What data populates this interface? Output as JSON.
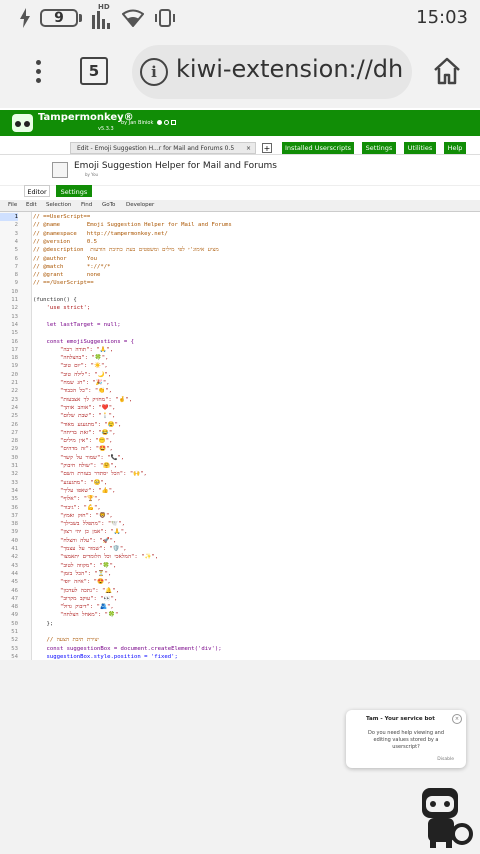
{
  "status_bar": {
    "battery_level": "9",
    "network": "HD",
    "time": "15:03"
  },
  "browser": {
    "tab_count": "5",
    "url": "kiwi-extension://dhc"
  },
  "tampermonkey": {
    "title": "Tampermonkey®",
    "by": "by Jan Biniok",
    "version": "v5.3.3",
    "edit_tab_label": "Edit - Emoji Suggestion H...r for Mail and Forums 0.5",
    "close_glyph": "×",
    "plus_glyph": "+",
    "nav": [
      "Installed Userscripts",
      "Settings",
      "Utilities",
      "Help"
    ]
  },
  "script": {
    "title": "Emoji Suggestion Helper for Mail and Forums",
    "by": "by You",
    "subtabs": [
      "Editor",
      "Settings"
    ]
  },
  "editor_menu": [
    "File",
    "Edit",
    "Selection",
    "Find",
    "GoTo",
    "Developer"
  ],
  "code_lines": [
    {
      "n": "1",
      "t": "// ==UserScript==",
      "c": "comment"
    },
    {
      "n": "2",
      "t": "// @name        Emoji Suggestion Helper for Mail and Forums",
      "c": "comment"
    },
    {
      "n": "3",
      "t": "// @namespace   http://tampermonkey.net/",
      "c": "comment"
    },
    {
      "n": "4",
      "t": "// @version     0.5",
      "c": "comment"
    },
    {
      "n": "5",
      "t": "// @description  מציע אימוג'י לפי מילים ומשפטים בעת כתיבת הודעות",
      "c": "comment"
    },
    {
      "n": "6",
      "t": "// @author      You",
      "c": "comment"
    },
    {
      "n": "7",
      "t": "// @match       *://*/*",
      "c": "comment"
    },
    {
      "n": "8",
      "t": "// @grant       none",
      "c": "comment"
    },
    {
      "n": "9",
      "t": "// ==/UserScript==",
      "c": "comment"
    },
    {
      "n": "10",
      "t": "",
      "c": "plain"
    },
    {
      "n": "11",
      "t": "(function() {",
      "c": "plain"
    },
    {
      "n": "12",
      "t": "    'use strict';",
      "c": "str"
    },
    {
      "n": "13",
      "t": "",
      "c": "plain"
    },
    {
      "n": "14",
      "t": "    let lastTarget = null;",
      "c": "kw"
    },
    {
      "n": "15",
      "t": "",
      "c": "plain"
    },
    {
      "n": "16",
      "t": "    const emojiSuggestions = {",
      "c": "kw"
    },
    {
      "n": "17",
      "t": "        \"תודה רבה\": \"🙏\",",
      "c": "str"
    },
    {
      "n": "18",
      "t": "        \"בהצלחה\": \"🍀\",",
      "c": "str"
    },
    {
      "n": "19",
      "t": "        \"יום טוב\": \"☀️\",",
      "c": "str"
    },
    {
      "n": "20",
      "t": "        \"לילה טוב\": \"🌙\",",
      "c": "str"
    },
    {
      "n": "21",
      "t": "        \"חג שמח\": \"🎉\",",
      "c": "str"
    },
    {
      "n": "22",
      "t": "        \"כל הכבוד\": \"👏\",",
      "c": "str"
    },
    {
      "n": "23",
      "t": "        \"מחזיק לך אצבעות\": \"🤞\",",
      "c": "str"
    },
    {
      "n": "24",
      "t": "        \"אוהב אותך\": \"❤️\",",
      "c": "str"
    },
    {
      "n": "25",
      "t": "        \"שבת שלום\": \"🕯️\",",
      "c": "str"
    },
    {
      "n": "26",
      "t": "        \"מתגעגע מאוד\": \"😢\",",
      "c": "str"
    },
    {
      "n": "27",
      "t": "        \"זאת בדיחה\": \"😂\",",
      "c": "str"
    },
    {
      "n": "28",
      "t": "        \"אין מילים\": \"😶\",",
      "c": "str"
    },
    {
      "n": "29",
      "t": "        \"זה מדהים\": \"🤩\",",
      "c": "str"
    },
    {
      "n": "30",
      "t": "        \"שמור על קשר\": \"📞\",",
      "c": "str"
    },
    {
      "n": "31",
      "t": "        \"שולח חיבוק\": \"🤗\",",
      "c": "str"
    },
    {
      "n": "32",
      "t": "        \"הכל יסתדר בעזרת השם\": \"🙌\",",
      "c": "str"
    },
    {
      "n": "33",
      "t": "        \"מתגעגע\": \"🥺\",",
      "c": "str"
    },
    {
      "n": "34",
      "t": "        \"שאפו עליך\": \"👍\",",
      "c": "str"
    },
    {
      "n": "35",
      "t": "        \"אלוף\": \"🏆\",",
      "c": "str"
    },
    {
      "n": "36",
      "t": "        \"גיבור\": \"💪\",",
      "c": "str"
    },
    {
      "n": "37",
      "t": "        \"חזק ואמץ\": \"🦁\",",
      "c": "str"
    },
    {
      "n": "38",
      "t": "        \"מתפלל בשבילך\": \"🕊️\",",
      "c": "str"
    },
    {
      "n": "39",
      "t": "        \"אמן כן יהי רצון\": \"🙏\",",
      "c": "str"
    },
    {
      "n": "40",
      "t": "        \"עלה והצלח\": \"🚀\",",
      "c": "str"
    },
    {
      "n": "41",
      "t": "        \"שמור על עצמך\": \"🛡️\",",
      "c": "str"
    },
    {
      "n": "42",
      "t": "        \"המלאכי וכל הלומדים יתאמצו\": \"✨\",",
      "c": "str"
    },
    {
      "n": "43",
      "t": "        \"מקווה לטוב\": \"🍀\",",
      "c": "str"
    },
    {
      "n": "44",
      "t": "        \"הכל בזמן\": \"⏳\",",
      "c": "str"
    },
    {
      "n": "45",
      "t": "        \"איזה יופי\": \"😍\",",
      "c": "str"
    },
    {
      "n": "46",
      "t": "        \"נתכה לעדכון\": \"🔔\",",
      "c": "str"
    },
    {
      "n": "47",
      "t": "        \"עוקב מקרוב\": \"👀\",",
      "c": "str"
    },
    {
      "n": "48",
      "t": "        \"דיבוק גדול\": \"🫂\",",
      "c": "str"
    },
    {
      "n": "49",
      "t": "        \"מאחל הצלחה\": \"🍀\"",
      "c": "str"
    },
    {
      "n": "50",
      "t": "    };",
      "c": "plain"
    },
    {
      "n": "51",
      "t": "",
      "c": "plain"
    },
    {
      "n": "52",
      "t": "    // יצירת תיבת הצעה",
      "c": "comment"
    },
    {
      "n": "53",
      "t": "    const suggestionBox = document.createElement('div');",
      "c": "kw"
    },
    {
      "n": "54",
      "t": "    suggestionBox.style.position = 'fixed';",
      "c": "def"
    }
  ],
  "service_bot": {
    "title": "Tam - Your service bot",
    "message": "Do you need help viewing and editing values stored by a userscript?",
    "disable": "Disable",
    "close_glyph": "×"
  }
}
